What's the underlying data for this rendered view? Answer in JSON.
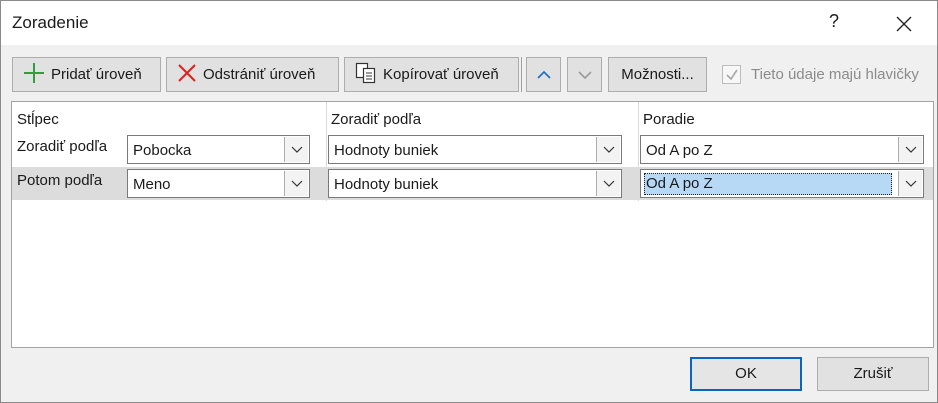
{
  "window": {
    "title": "Zoradenie",
    "help_label": "?"
  },
  "toolbar": {
    "add_label": "Pridať úroveň",
    "delete_label": "Odstrániť úroveň",
    "copy_label": "Kopírovať úroveň",
    "options_label": "Možnosti...",
    "header_checkbox_label": "Tieto údaje majú hlavičky",
    "header_checkbox_checked": true
  },
  "grid": {
    "headers": {
      "column": "Stĺpec",
      "sort_on": "Zoradiť podľa",
      "order": "Poradie"
    },
    "rows": [
      {
        "label": "Zoradiť podľa",
        "column": "Pobocka",
        "sort_on": "Hodnoty buniek",
        "order": "Od A po Z"
      },
      {
        "label": "Potom podľa",
        "column": "Meno",
        "sort_on": "Hodnoty buniek",
        "order": "Od A po Z"
      }
    ]
  },
  "footer": {
    "ok_label": "OK",
    "cancel_label": "Zrušiť"
  },
  "colors": {
    "accent": "#0a64c8",
    "add_icon": "#2e9e3e",
    "delete_icon": "#e02020",
    "selection": "#b8d9f5"
  }
}
